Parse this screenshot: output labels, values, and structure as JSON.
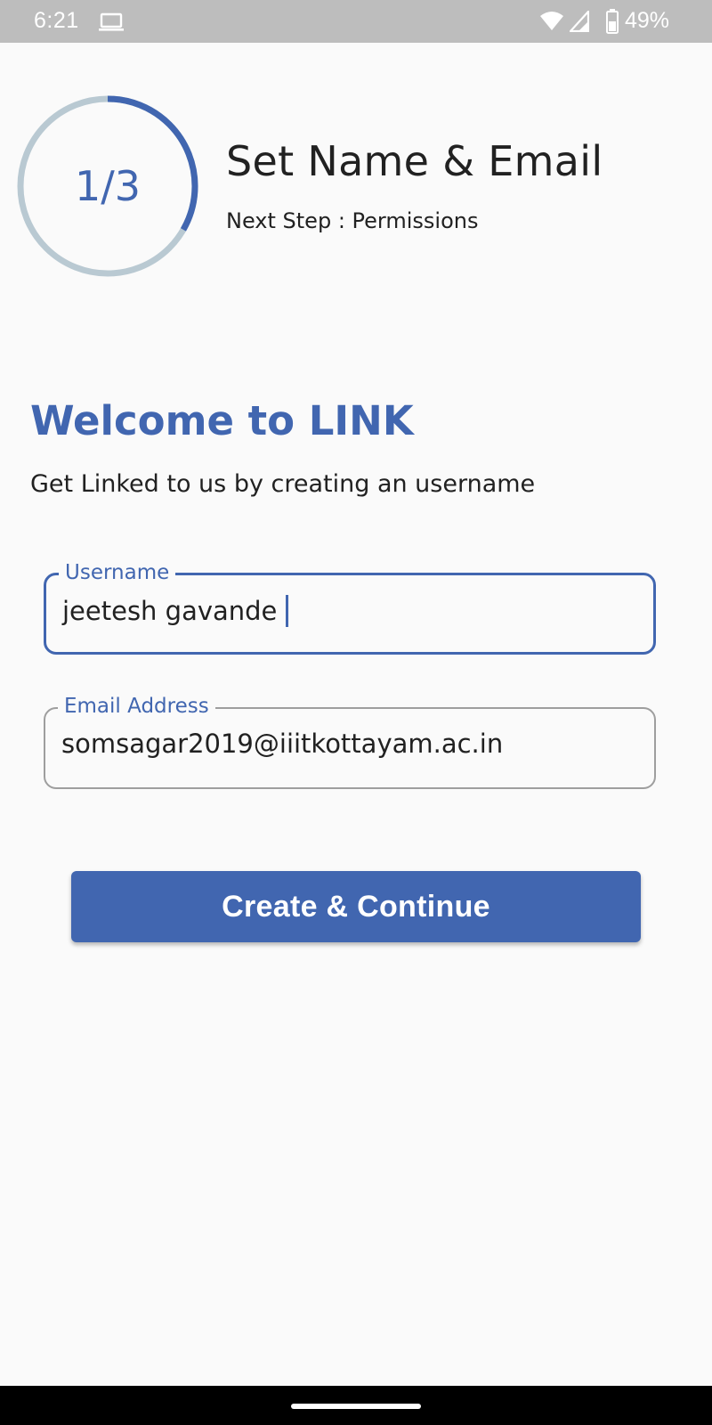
{
  "status_bar": {
    "time": "6:21",
    "battery": "49%",
    "icons": [
      "laptop-icon",
      "wifi-icon",
      "signal-icon",
      "battery-icon"
    ]
  },
  "progress": {
    "label": "1/3",
    "fraction": 0.333,
    "ring_color": "#4166b0",
    "track_color": "#b9c9d2"
  },
  "step": {
    "title": "Set Name & Email",
    "next": "Next Step : Permissions"
  },
  "welcome": {
    "title": "Welcome to LINK",
    "subtitle": "Get Linked to us by creating an username"
  },
  "form": {
    "username_label": "Username",
    "username_value": "jeetesh gavande",
    "email_label": "Email Address",
    "email_value": "somsagar2019@iiitkottayam.ac.in"
  },
  "actions": {
    "primary_label": "Create & Continue"
  },
  "colors": {
    "accent": "#4166b0",
    "background": "#fafafa",
    "status_bar": "#bdbdbd"
  }
}
